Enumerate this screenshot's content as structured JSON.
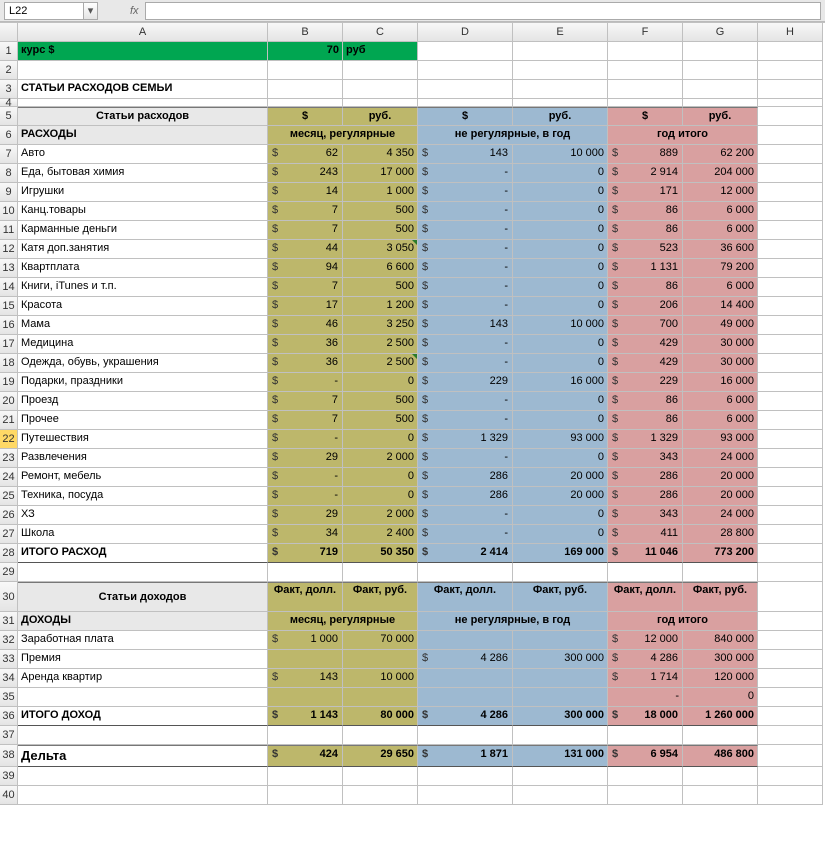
{
  "namebox": "L22",
  "formula": "",
  "cols": [
    "A",
    "B",
    "C",
    "D",
    "E",
    "F",
    "G",
    "H"
  ],
  "kurs_label": "курс $",
  "kurs_val": "70",
  "kurs_unit": "руб",
  "section_title": "СТАТЬИ РАСХОДОВ СЕМЬИ",
  "hdr_expenses": "Статьи расходов",
  "hdr_dollar": "$",
  "hdr_rub": "руб.",
  "exp_title": "РАСХОДЫ",
  "month_reg": "месяц, регулярные",
  "year_irreg": "не регулярные, в год",
  "year_total": "год итого",
  "exp_rows": [
    {
      "r": "7",
      "name": "Авто",
      "b": "62",
      "c": "4 350",
      "d": "143",
      "e": "10 000",
      "f": "889",
      "g": "62 200"
    },
    {
      "r": "8",
      "name": "Еда, бытовая химия",
      "b": "243",
      "c": "17 000",
      "d": "-",
      "e": "0",
      "f": "2 914",
      "g": "204 000"
    },
    {
      "r": "9",
      "name": "Игрушки",
      "b": "14",
      "c": "1 000",
      "d": "-",
      "e": "0",
      "f": "171",
      "g": "12 000"
    },
    {
      "r": "10",
      "name": "Канц.товары",
      "b": "7",
      "c": "500",
      "d": "-",
      "e": "0",
      "f": "86",
      "g": "6 000"
    },
    {
      "r": "11",
      "name": "Карманные деньги",
      "b": "7",
      "c": "500",
      "d": "-",
      "e": "0",
      "f": "86",
      "g": "6 000"
    },
    {
      "r": "12",
      "name": "Катя доп.занятия",
      "b": "44",
      "c": "3 050",
      "d": "-",
      "e": "0",
      "f": "523",
      "g": "36 600",
      "tri": true
    },
    {
      "r": "13",
      "name": "Квартплата",
      "b": "94",
      "c": "6 600",
      "d": "-",
      "e": "0",
      "f": "1 131",
      "g": "79 200"
    },
    {
      "r": "14",
      "name": "Книги, iTunes и т.п.",
      "b": "7",
      "c": "500",
      "d": "-",
      "e": "0",
      "f": "86",
      "g": "6 000"
    },
    {
      "r": "15",
      "name": "Красота",
      "b": "17",
      "c": "1 200",
      "d": "-",
      "e": "0",
      "f": "206",
      "g": "14 400"
    },
    {
      "r": "16",
      "name": "Мама",
      "b": "46",
      "c": "3 250",
      "d": "143",
      "e": "10 000",
      "f": "700",
      "g": "49 000"
    },
    {
      "r": "17",
      "name": "Медицина",
      "b": "36",
      "c": "2 500",
      "d": "-",
      "e": "0",
      "f": "429",
      "g": "30 000"
    },
    {
      "r": "18",
      "name": "Одежда, обувь, украшения",
      "b": "36",
      "c": "2 500",
      "d": "-",
      "e": "0",
      "f": "429",
      "g": "30 000",
      "tri": true
    },
    {
      "r": "19",
      "name": "Подарки, праздники",
      "b": "-",
      "c": "0",
      "d": "229",
      "e": "16 000",
      "f": "229",
      "g": "16 000"
    },
    {
      "r": "20",
      "name": "Проезд",
      "b": "7",
      "c": "500",
      "d": "-",
      "e": "0",
      "f": "86",
      "g": "6 000"
    },
    {
      "r": "21",
      "name": "Прочее",
      "b": "7",
      "c": "500",
      "d": "-",
      "e": "0",
      "f": "86",
      "g": "6 000"
    },
    {
      "r": "22",
      "name": "Путешествия",
      "b": "-",
      "c": "0",
      "d": "1 329",
      "e": "93 000",
      "f": "1 329",
      "g": "93 000",
      "sel": true
    },
    {
      "r": "23",
      "name": "Развлечения",
      "b": "29",
      "c": "2 000",
      "d": "-",
      "e": "0",
      "f": "343",
      "g": "24 000"
    },
    {
      "r": "24",
      "name": "Ремонт, мебель",
      "b": "-",
      "c": "0",
      "d": "286",
      "e": "20 000",
      "f": "286",
      "g": "20 000"
    },
    {
      "r": "25",
      "name": "Техника, посуда",
      "b": "-",
      "c": "0",
      "d": "286",
      "e": "20 000",
      "f": "286",
      "g": "20 000"
    },
    {
      "r": "26",
      "name": "ХЗ",
      "b": "29",
      "c": "2 000",
      "d": "-",
      "e": "0",
      "f": "343",
      "g": "24 000"
    },
    {
      "r": "27",
      "name": "Школа",
      "b": "34",
      "c": "2 400",
      "d": "-",
      "e": "0",
      "f": "411",
      "g": "28 800"
    }
  ],
  "exp_total": {
    "r": "28",
    "name": "ИТОГО РАСХОД",
    "b": "719",
    "c": "50 350",
    "d": "2 414",
    "e": "169 000",
    "f": "11 046",
    "g": "773 200"
  },
  "hdr_income": "Статьи доходов",
  "fact_doll": "Факт, долл.",
  "fact_rub": "Факт, руб.",
  "inc_title": "ДОХОДЫ",
  "inc_rows": [
    {
      "r": "32",
      "name": "Заработная плата",
      "b": "1 000",
      "c": "70 000",
      "d": "",
      "e": "",
      "f": "12 000",
      "g": "840 000"
    },
    {
      "r": "33",
      "name": "Премия",
      "b": "",
      "c": "",
      "d": "4 286",
      "e": "300 000",
      "f": "4 286",
      "g": "300 000"
    },
    {
      "r": "34",
      "name": "Аренда квартир",
      "b": "143",
      "c": "10 000",
      "d": "",
      "e": "",
      "f": "1 714",
      "g": "120 000"
    },
    {
      "r": "35",
      "name": "",
      "b": "",
      "c": "",
      "d": "",
      "e": "",
      "f": "-",
      "g": "0"
    }
  ],
  "inc_total": {
    "r": "36",
    "name": "ИТОГО ДОХОД",
    "b": "1 143",
    "c": "80 000",
    "d": "4 286",
    "e": "300 000",
    "f": "18 000",
    "g": "1 260 000"
  },
  "delta": {
    "r": "38",
    "name": "Дельта",
    "b": "424",
    "c": "29 650",
    "d": "1 871",
    "e": "131 000",
    "f": "6 954",
    "g": "486 800"
  }
}
